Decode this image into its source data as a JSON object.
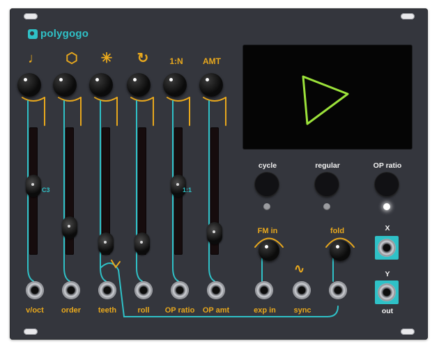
{
  "module": {
    "brand": "polygogo",
    "panel_color": "#34363d",
    "accent_cyan": "#2fc1c7",
    "accent_orange": "#e8a81d"
  },
  "top_symbols": [
    {
      "name": "note-icon",
      "label": "♩"
    },
    {
      "name": "hexagon-icon",
      "label": "⬡"
    },
    {
      "name": "asterisk-icon",
      "label": "✳"
    },
    {
      "name": "roll-arrow-icon",
      "label": "↻"
    },
    {
      "name": "ratio-label",
      "label": "1:N"
    },
    {
      "name": "amt-label",
      "label": "AMT"
    }
  ],
  "sliders": [
    {
      "id": "voct",
      "level": 0.55,
      "value_label": "C3"
    },
    {
      "id": "order",
      "level": 0.15,
      "value_label": ""
    },
    {
      "id": "teeth",
      "level": 0.0,
      "value_label": ""
    },
    {
      "id": "roll",
      "level": 0.0,
      "value_label": ""
    },
    {
      "id": "op-ratio",
      "level": 0.55,
      "value_label": "1:1"
    },
    {
      "id": "op-amt",
      "level": 0.1,
      "value_label": ""
    }
  ],
  "bottom_jacks": [
    {
      "id": "voct",
      "label": "v/oct"
    },
    {
      "id": "order",
      "label": "order"
    },
    {
      "id": "teeth",
      "label": "teeth"
    },
    {
      "id": "roll",
      "label": "roll"
    },
    {
      "id": "op-ratio",
      "label": "OP ratio"
    },
    {
      "id": "op-amt",
      "label": "OP amt"
    }
  ],
  "display": {
    "shape_color": "#9be13a",
    "shape": "triangle"
  },
  "buttons": [
    {
      "id": "cycle",
      "label": "cycle",
      "led": "off"
    },
    {
      "id": "regular",
      "label": "regular",
      "led": "off"
    },
    {
      "id": "op-ratio",
      "label": "OP ratio",
      "led": "on"
    }
  ],
  "small_knobs": [
    {
      "id": "fm-in",
      "label": "FM in"
    },
    {
      "id": "fold",
      "label": "fold"
    }
  ],
  "lower_jacks": [
    {
      "id": "exp-in",
      "label": "exp in"
    },
    {
      "id": "sync",
      "label": "sync"
    },
    {
      "id": "fold-in",
      "label": ""
    }
  ],
  "outputs": [
    {
      "id": "x",
      "label": "X"
    },
    {
      "id": "y",
      "label": "Y",
      "sub_label": "out"
    }
  ]
}
